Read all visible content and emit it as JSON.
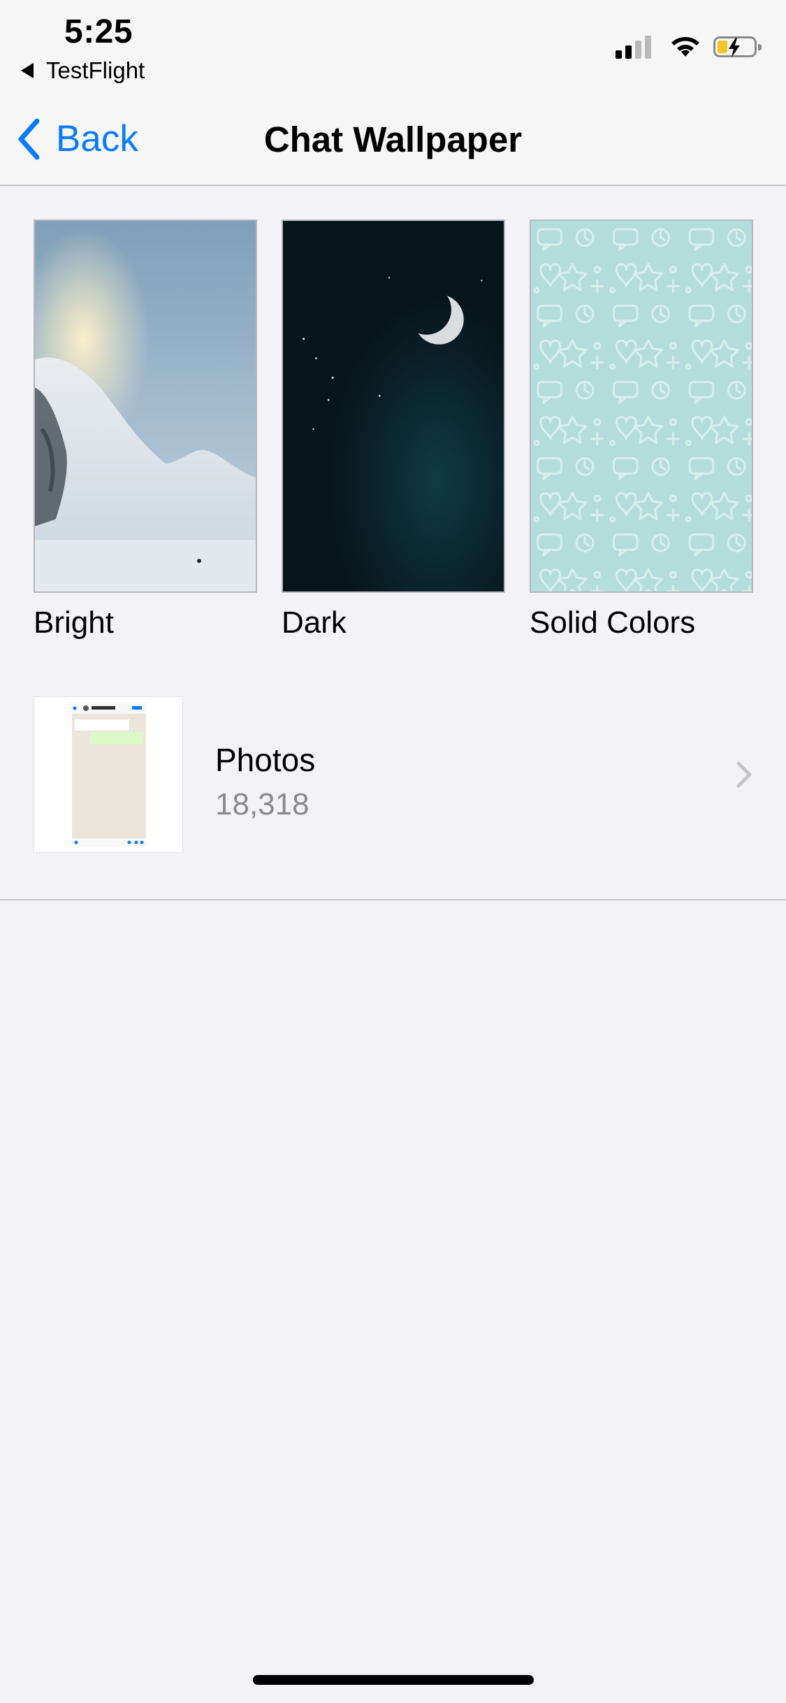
{
  "status_bar": {
    "time": "5:25",
    "back_app": "TestFlight",
    "signal_bars_active": 2,
    "signal_bars_total": 4,
    "battery_level": 0.2,
    "battery_charging": true,
    "colors": {
      "battery_fill": "#f3c623"
    }
  },
  "nav": {
    "back_label": "Back",
    "title": "Chat Wallpaper",
    "back_icon": "chevron-left-icon",
    "accent_color": "#0a7aff"
  },
  "wallpapers": {
    "items": [
      {
        "label": "Bright",
        "image": "snowy-mountain-image"
      },
      {
        "label": "Dark",
        "image": "crescent-moon-night-image"
      },
      {
        "label": "Solid Colors",
        "image": "doodle-pattern-image"
      }
    ]
  },
  "photos": {
    "label": "Photos",
    "count": "18,318",
    "icon": "chevron-right-icon"
  }
}
